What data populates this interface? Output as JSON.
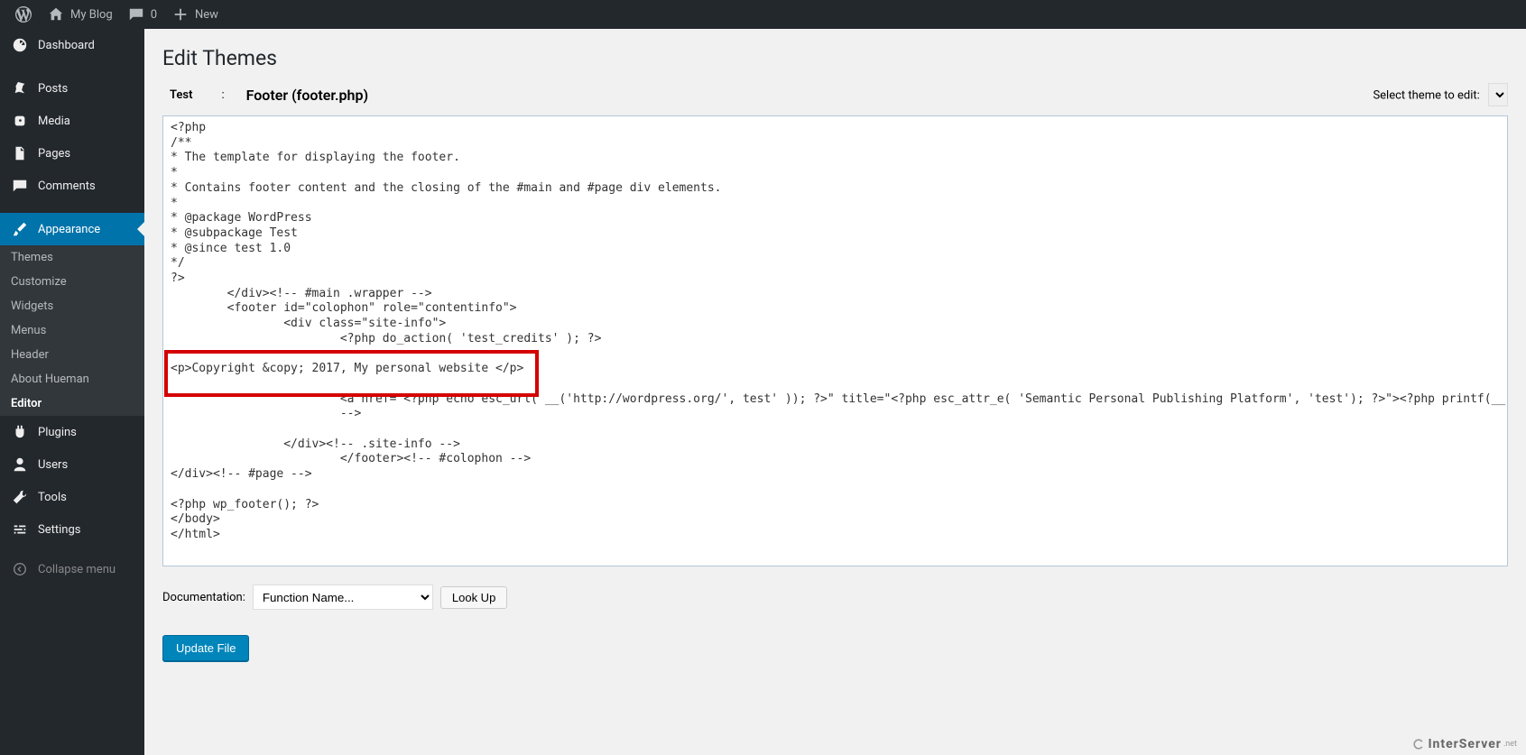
{
  "adminbar": {
    "site_name": "My Blog",
    "comments_count": "0",
    "new_label": "New"
  },
  "sidebar": {
    "dashboard": "Dashboard",
    "posts": "Posts",
    "media": "Media",
    "pages": "Pages",
    "comments": "Comments",
    "appearance": "Appearance",
    "plugins": "Plugins",
    "users": "Users",
    "tools": "Tools",
    "settings": "Settings",
    "collapse": "Collapse menu",
    "sub": {
      "themes": "Themes",
      "customize": "Customize",
      "widgets": "Widgets",
      "menus": "Menus",
      "header": "Header",
      "about_hueman": "About Hueman",
      "editor": "Editor"
    }
  },
  "editor": {
    "page_title": "Edit Themes",
    "theme_name": "Test",
    "separator": ":",
    "file_title": "Footer (footer.php)",
    "select_theme_label": "Select theme to edit:",
    "code": "<?php\n/**\n* The template for displaying the footer.\n*\n* Contains footer content and the closing of the #main and #page div elements.\n*\n* @package WordPress\n* @subpackage Test\n* @since test 1.0\n*/\n?>\n        </div><!-- #main .wrapper -->\n        <footer id=\"colophon\" role=\"contentinfo\">\n                <div class=\"site-info\">\n                        <?php do_action( 'test_credits' ); ?>\n\n<p>Copyright &copy; 2017, My personal website </p>\n\n                        <a href=\"<?php echo esc_url( __('http://wordpress.org/', test' )); ?>\" title=\"<?php esc_attr_e( 'Semantic Personal Publishing Platform', 'test'); ?>\"><?php printf(__( 'Proudly powered by %s' ,'test' ), 'WordPress' ); ?></a> - <a href=\"http://www.example.com\">Example </a&gt\n                        -->\n\n                </div><!-- .site-info -->\n                        </footer><!-- #colophon -->\n</div><!-- #page -->\n\n<?php wp_footer(); ?>\n</body>\n</html>",
    "documentation_label": "Documentation:",
    "function_placeholder": "Function Name...",
    "lookup_label": "Look Up",
    "update_label": "Update File"
  },
  "watermark": {
    "brand": "InterServer",
    "suffix": ".net"
  }
}
